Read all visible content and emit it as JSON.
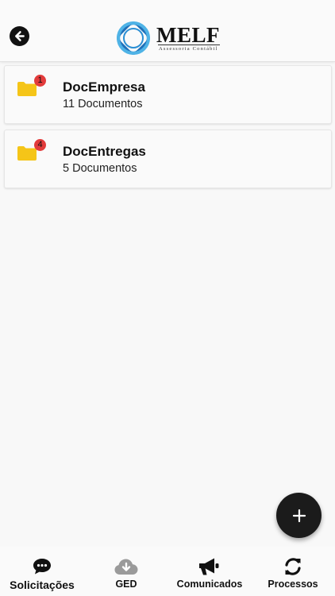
{
  "header": {
    "brand_name": "MELF",
    "brand_tagline": "Assessoria Contábil",
    "back_icon": "arrow-left-icon",
    "colors": {
      "brand_blue": "#1f6fb8",
      "brand_light_blue": "#4fb3e6"
    }
  },
  "folders": [
    {
      "title": "DocEmpresa",
      "subtitle": "11 Documentos",
      "badge": "1",
      "icon": "folder-icon"
    },
    {
      "title": "DocEntregas",
      "subtitle": "5 Documentos",
      "badge": "4",
      "icon": "folder-icon"
    }
  ],
  "fab": {
    "icon": "plus-icon"
  },
  "tabs": [
    {
      "label": "Solicitações",
      "icon": "chat-bubble-icon",
      "active": true
    },
    {
      "label": "GED",
      "icon": "cloud-download-icon",
      "active": false
    },
    {
      "label": "Comunicados",
      "icon": "megaphone-icon",
      "active": false
    },
    {
      "label": "Processos",
      "icon": "sync-icon",
      "active": false
    }
  ],
  "colors": {
    "folder": "#f5c518",
    "badge": "#e23b3b",
    "fab": "#1b1b1b",
    "inactive_icon": "#9a9a9a"
  }
}
